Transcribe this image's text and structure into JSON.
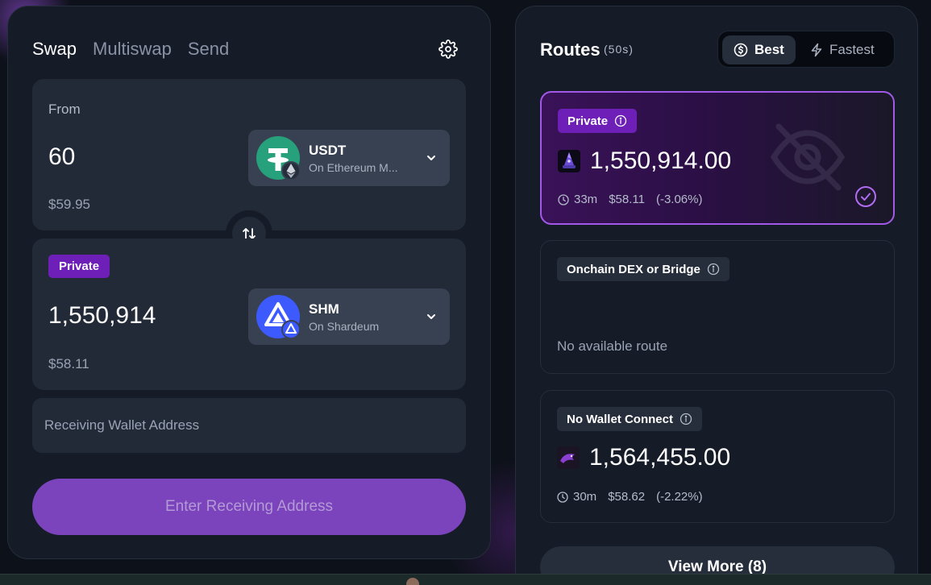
{
  "swap": {
    "tabs": [
      {
        "label": "Swap",
        "active": true
      },
      {
        "label": "Multiswap",
        "active": false
      },
      {
        "label": "Send",
        "active": false
      }
    ],
    "from": {
      "label": "From",
      "amount": "60",
      "usd": "$59.95",
      "token": {
        "symbol": "USDT",
        "network": "On Ethereum M..."
      }
    },
    "to": {
      "badge": "Private",
      "amount": "1,550,914",
      "usd": "$58.11",
      "token": {
        "symbol": "SHM",
        "network": "On Shardeum"
      }
    },
    "address_placeholder": "Receiving Wallet Address",
    "cta_label": "Enter Receiving Address"
  },
  "routes": {
    "title": "Routes",
    "timer": "(50s)",
    "toggle": {
      "best": "Best",
      "fastest": "Fastest",
      "selected": "best"
    },
    "cards": [
      {
        "tag": "Private",
        "amount": "1,550,914.00",
        "time": "33m",
        "usd": "$58.11",
        "change": "(-3.06%)",
        "selected": true
      },
      {
        "tag": "Onchain DEX or Bridge",
        "message": "No available route"
      },
      {
        "tag": "No Wallet Connect",
        "amount": "1,564,455.00",
        "time": "30m",
        "usd": "$58.62",
        "change": "(-2.22%)"
      }
    ],
    "view_more": "View More (8)"
  },
  "colors": {
    "accent": "#7b44bd",
    "private_badge": "#6d1fb8",
    "selected_border": "#a259e8",
    "usdt_green": "#26a17b",
    "shm_blue": "#3d5afe"
  }
}
